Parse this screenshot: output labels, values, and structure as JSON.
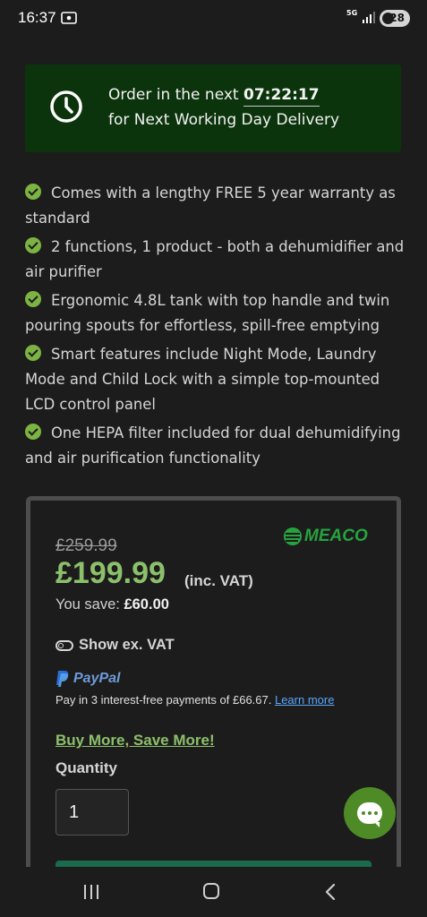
{
  "status_bar": {
    "time": "16:37",
    "network": "5G",
    "battery": "28"
  },
  "delivery": {
    "line1_prefix": "Order in the next ",
    "countdown": "07:22:17",
    "line2": "for Next Working Day Delivery"
  },
  "features": [
    "Comes with a lengthy FREE 5 year warranty as standard",
    "2 functions, 1 product - both a dehumidifier and air purifier",
    "Ergonomic 4.8L tank with top handle and twin pouring spouts for effortless, spill-free emptying",
    "Smart features include Night Mode, Laundry Mode and Child Lock with a simple top-mounted LCD control panel",
    "One HEPA filter included for dual dehumidifying and air purification functionality"
  ],
  "product": {
    "brand": "MEACO",
    "old_price": "£259.99",
    "price": "£199.99",
    "price_suffix": "(inc. VAT)",
    "you_save_label": "You save: ",
    "you_save_value": "£60.00",
    "vat_toggle_label": "Show ex. VAT",
    "paypal_label": "PayPal",
    "pay_in_text": "Pay in 3 interest-free payments of £66.67. ",
    "learn_more": "Learn more",
    "buy_more": "Buy More, Save More!",
    "quantity_label": "Quantity",
    "quantity_value": "1"
  },
  "colors": {
    "accent_green": "#8cc06b",
    "delivery_bg": "#0c340c",
    "brand_green": "#26a33f",
    "paypal_blue": "#6e9bd8",
    "link_blue": "#5aa7ff"
  }
}
